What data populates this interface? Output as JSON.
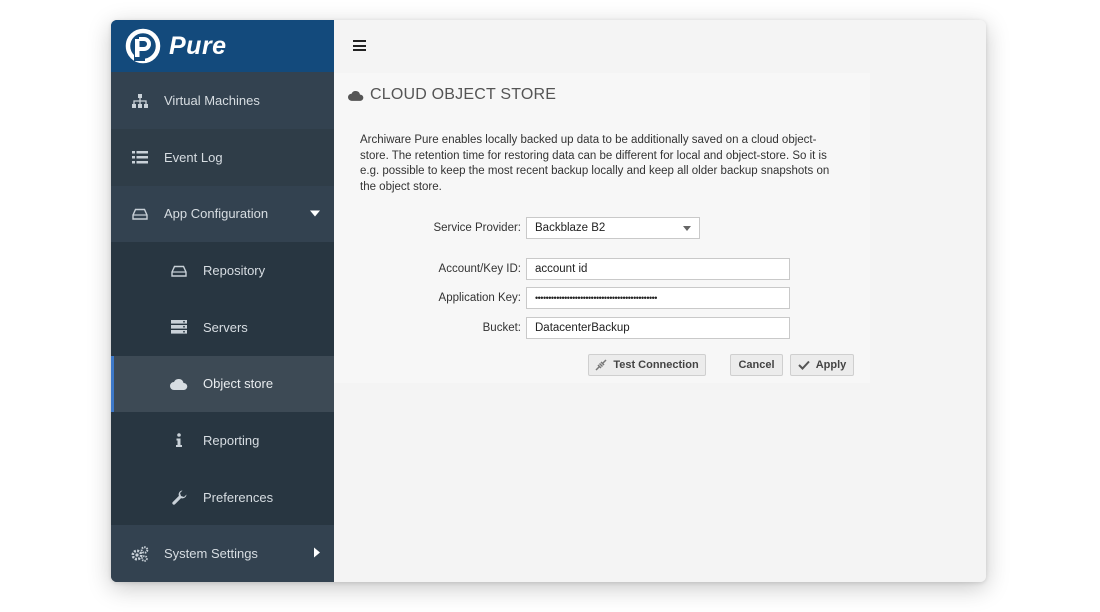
{
  "brand": {
    "name": "Pure",
    "color": "#134a7c"
  },
  "menu_icon": "hamburger-icon",
  "sidebar": {
    "items": [
      {
        "label": "Virtual Machines",
        "icon": "sitemap-icon",
        "level": "top"
      },
      {
        "label": "Event Log",
        "icon": "list-icon",
        "level": "top"
      },
      {
        "label": "App Configuration",
        "icon": "drive-icon",
        "level": "top",
        "expanded": true
      },
      {
        "label": "Repository",
        "icon": "drive-icon",
        "level": "sub"
      },
      {
        "label": "Servers",
        "icon": "server-icon",
        "level": "sub"
      },
      {
        "label": "Object store",
        "icon": "cloud-icon",
        "level": "sub",
        "active": true
      },
      {
        "label": "Reporting",
        "icon": "info-icon",
        "level": "sub"
      },
      {
        "label": "Preferences",
        "icon": "wrench-icon",
        "level": "sub"
      },
      {
        "label": "System Settings",
        "icon": "cogs-icon",
        "level": "top",
        "expanded": false
      }
    ]
  },
  "panel": {
    "title": "CLOUD OBJECT STORE",
    "description": "Archiware Pure enables locally backed up data to be additionally saved on a cloud object-store. The retention time for restoring data can be different for local and object-store. So it is e.g. possible to keep the most recent backup locally and keep all older backup snapshots on the object store."
  },
  "form": {
    "service_provider_label": "Service Provider:",
    "service_provider_value": "Backblaze B2",
    "account_label": "Account/Key ID:",
    "account_value": "account id",
    "app_key_label": "Application Key:",
    "app_key_value": "••••••••••••••••••••••••••••••••••••••••••••••",
    "bucket_label": "Bucket:",
    "bucket_value": "DatacenterBackup"
  },
  "buttons": {
    "test_connection": "Test Connection",
    "cancel": "Cancel",
    "apply": "Apply"
  },
  "colors": {
    "sidebar": "#2f3d48",
    "active_accent": "#3c78c8"
  }
}
